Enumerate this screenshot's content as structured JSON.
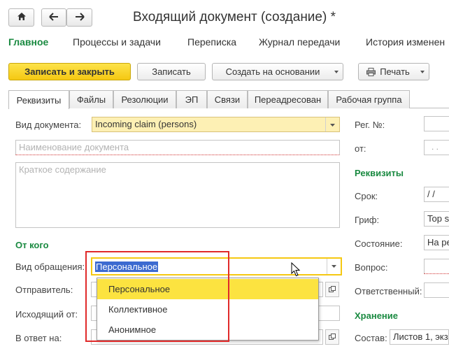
{
  "window": {
    "title": "Входящий документ (создание) *"
  },
  "nav": {
    "home_icon": "home-icon",
    "back_icon": "arrow-left-icon",
    "forward_icon": "arrow-right-icon"
  },
  "sections": [
    {
      "label": "Главное",
      "active": true
    },
    {
      "label": "Процессы и задачи"
    },
    {
      "label": "Переписка"
    },
    {
      "label": "Журнал передачи"
    },
    {
      "label": "История изменен"
    }
  ],
  "toolbar": {
    "save_close": "Записать и закрыть",
    "save": "Записать",
    "create_based": "Создать на основании",
    "print": "Печать"
  },
  "tabs": [
    "Реквизиты",
    "Файлы",
    "Резолюции",
    "ЭП",
    "Связи",
    "Переадресован",
    "Рабочая группа"
  ],
  "form": {
    "doc_type_label": "Вид документа:",
    "doc_type_value": "Incoming claim (persons)",
    "doc_name_placeholder": "Наименование документа",
    "summary_placeholder": "Краткое содержание",
    "from_group": "От кого",
    "appeal_type_label": "Вид обращения:",
    "appeal_type_value": "Персональное",
    "sender_label": "Отправитель:",
    "outgoing_from_label": "Исходящий от:",
    "reply_to_label": "В ответ на:"
  },
  "right_panel": {
    "reg_no_label": "Рег. №:",
    "from_label": "от:",
    "from_value": ". .",
    "group_requisites": "Реквизиты",
    "deadline_label": "Срок:",
    "deadline_value": "/  /",
    "stamp_label": "Гриф:",
    "stamp_value": "Top s",
    "state_label": "Состояние:",
    "state_value": "На ре",
    "question_label": "Вопрос:",
    "responsible_label": "Ответственный:",
    "group_storage": "Хранение",
    "composition_label": "Состав:",
    "composition_value": "Листов 1, экз"
  },
  "dropdown": {
    "options": [
      "Персональное",
      "Коллективное",
      "Анонимное"
    ],
    "selected_index": 0
  },
  "colors": {
    "accent_green": "#1a8a41",
    "primary_yellow": "#f5c812",
    "highlight_red": "#e02a2a"
  }
}
